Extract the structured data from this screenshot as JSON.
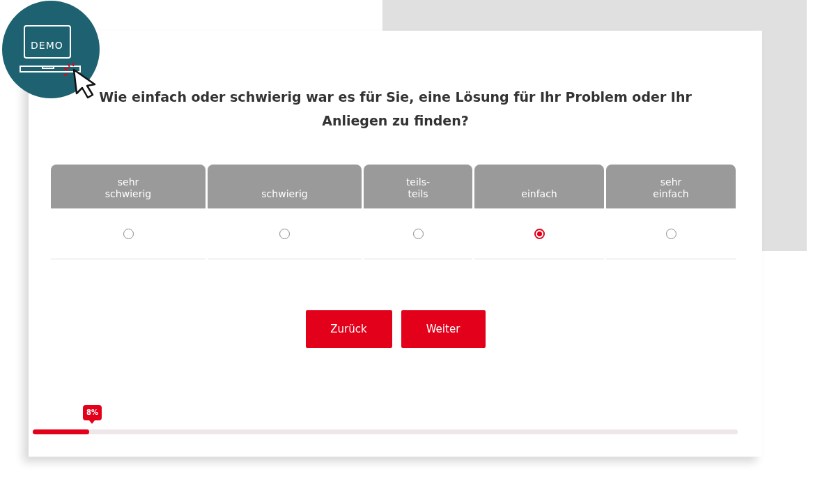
{
  "badge": {
    "label": "DEMO"
  },
  "question": "Wie einfach oder schwierig war es für Sie, eine Lösung für Ihr Problem oder Ihr Anliegen zu finden?",
  "options": [
    {
      "label": "sehr\nschwierig",
      "selected": false
    },
    {
      "label": "schwierig",
      "selected": false
    },
    {
      "label": "teils-\nteils",
      "selected": false
    },
    {
      "label": "einfach",
      "selected": true
    },
    {
      "label": "sehr\neinfach",
      "selected": false
    }
  ],
  "buttons": [
    {
      "label": "Zurück"
    },
    {
      "label": "Weiter"
    }
  ],
  "progress": {
    "level": 0.08,
    "reading": "8%"
  }
}
